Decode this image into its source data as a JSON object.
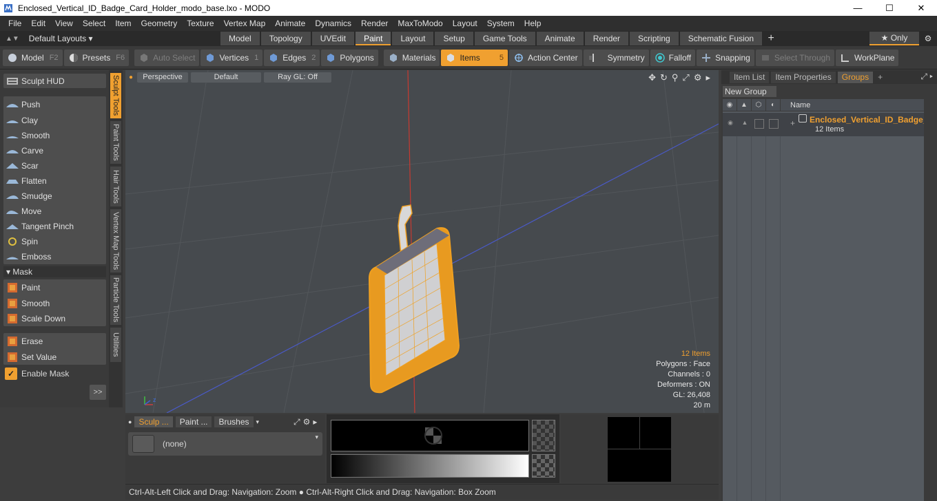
{
  "window": {
    "title": "Enclosed_Vertical_ID_Badge_Card_Holder_modo_base.lxo - MODO",
    "minimize": "—",
    "maximize": "☐",
    "close": "✕"
  },
  "menu": [
    "File",
    "Edit",
    "View",
    "Select",
    "Item",
    "Geometry",
    "Texture",
    "Vertex Map",
    "Animate",
    "Dynamics",
    "Render",
    "MaxToModo",
    "Layout",
    "System",
    "Help"
  ],
  "layouts": {
    "dropdown": "Default Layouts ▾",
    "tabs": [
      "Model",
      "Topology",
      "UVEdit",
      "Paint",
      "Layout",
      "Setup",
      "Game Tools",
      "Animate",
      "Render",
      "Scripting",
      "Schematic Fusion"
    ],
    "active_tab": "Paint",
    "only_label": "★  Only"
  },
  "toolbar": {
    "model": "Model",
    "model_key": "F2",
    "presets": "Presets",
    "presets_key": "F6",
    "auto_select": "Auto Select",
    "vertices": "Vertices",
    "vertices_key": "1",
    "edges": "Edges",
    "edges_key": "2",
    "polygons": "Polygons",
    "materials": "Materials",
    "items": "Items",
    "items_key": "5",
    "action_center": "Action Center",
    "symmetry": "Symmetry",
    "falloff": "Falloff",
    "snapping": "Snapping",
    "select_through": "Select Through",
    "workplane": "WorkPlane"
  },
  "leftpanel": {
    "sculpt_hud": "Sculpt HUD",
    "tools": [
      "Push",
      "Clay",
      "Smooth",
      "Carve",
      "Scar",
      "Flatten",
      "Smudge",
      "Move",
      "Tangent Pinch",
      "Spin",
      "Emboss"
    ],
    "mask_title": "Mask",
    "mask_tools": [
      "Paint",
      "Smooth",
      "Scale Down"
    ],
    "erase": "Erase",
    "set_value": "Set Value",
    "enable_mask": "Enable Mask",
    "more": ">>"
  },
  "vtabs": [
    "Sculpt Tools",
    "Paint Tools",
    "Hair Tools",
    "Vertex Map Tools",
    "Particle Tools",
    "Utilities"
  ],
  "viewport": {
    "view": "Perspective",
    "shading": "Default",
    "raygl": "Ray GL: Off",
    "info": {
      "items": "12 Items",
      "polygons": "Polygons : Face",
      "channels": "Channels : 0",
      "deformers": "Deformers : ON",
      "gl": "GL: 26,408",
      "scale": "20 m"
    }
  },
  "bottom": {
    "tabs": [
      "Sculp ...",
      "Paint ...",
      "Brushes"
    ],
    "brush_value": "(none)"
  },
  "status": "Ctrl-Alt-Left Click and Drag: Navigation: Zoom ● Ctrl-Alt-Right Click and Drag: Navigation: Box Zoom",
  "rightpanel": {
    "tabs": [
      "Item List",
      "Item Properties",
      "Groups"
    ],
    "active_tab": "Groups",
    "new_group": "New Group",
    "name_header": "Name",
    "group_name": "Enclosed_Vertical_ID_Badge_Card_Holder",
    "group_count": "12 Items"
  },
  "colors": {
    "accent": "#f0a030",
    "viewport_bg": "#464a4e"
  }
}
